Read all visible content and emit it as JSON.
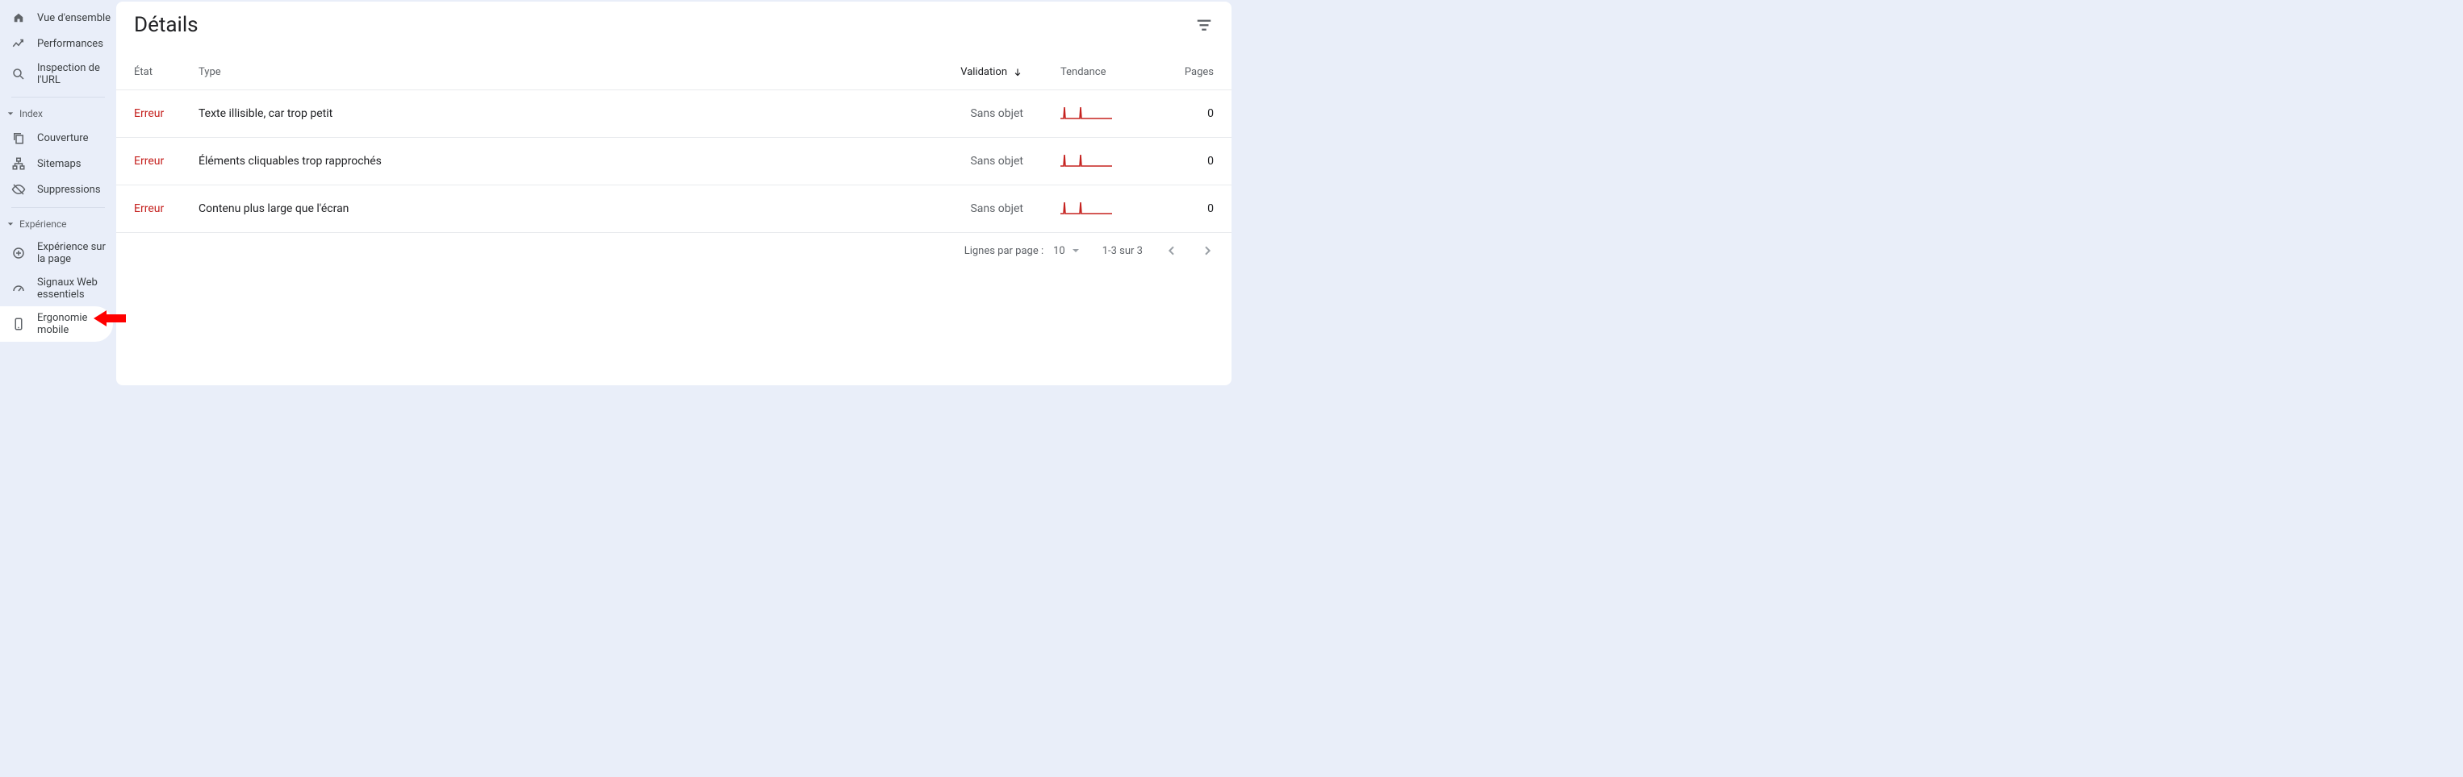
{
  "sidebar": {
    "top": [
      {
        "label": "Vue d'ensemble",
        "icon": "home"
      },
      {
        "label": "Performances",
        "icon": "trend"
      },
      {
        "label": "Inspection de l'URL",
        "icon": "search"
      }
    ],
    "section_index": "Index",
    "index_items": [
      {
        "label": "Couverture",
        "icon": "copy"
      },
      {
        "label": "Sitemaps",
        "icon": "sitemap"
      },
      {
        "label": "Suppressions",
        "icon": "hide"
      }
    ],
    "section_exp": "Expérience",
    "exp_items": [
      {
        "label": "Expérience sur la page",
        "icon": "plus-circle"
      },
      {
        "label": "Signaux Web essentiels",
        "icon": "speed"
      },
      {
        "label": "Ergonomie mobile",
        "icon": "phone"
      }
    ]
  },
  "main": {
    "title": "Détails",
    "columns": {
      "etat": "État",
      "type": "Type",
      "validation": "Validation",
      "tendance": "Tendance",
      "pages": "Pages"
    },
    "rows": [
      {
        "etat": "Erreur",
        "type": "Texte illisible, car trop petit",
        "validation": "Sans objet",
        "pages": "0"
      },
      {
        "etat": "Erreur",
        "type": "Éléments cliquables trop rapprochés",
        "validation": "Sans objet",
        "pages": "0"
      },
      {
        "etat": "Erreur",
        "type": "Contenu plus large que l'écran",
        "validation": "Sans objet",
        "pages": "0"
      }
    ],
    "footer": {
      "per_page_label": "Lignes par page :",
      "per_page_value": "10",
      "range": "1-3 sur 3"
    }
  }
}
